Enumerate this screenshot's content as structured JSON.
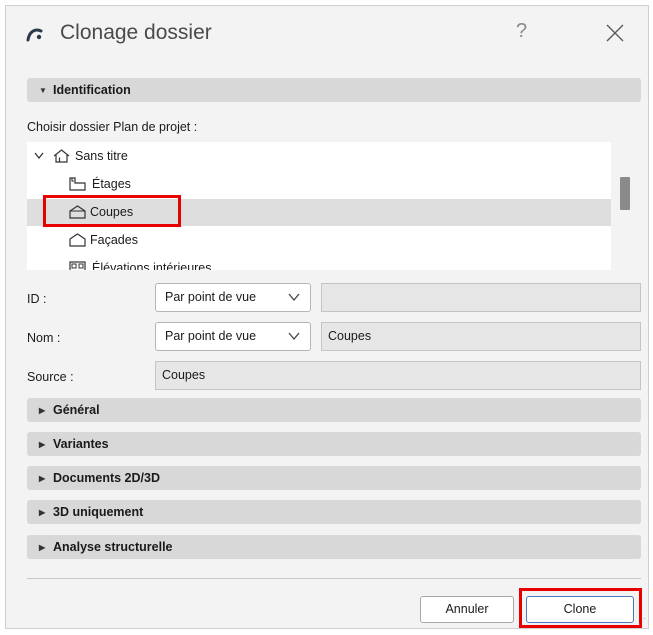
{
  "dialog": {
    "title": "Clonage dossier",
    "help_label": "?",
    "app_icon": "archicad-logo-icon",
    "close_icon": "close-icon"
  },
  "identification": {
    "header": "Identification",
    "choose_label": "Choisir dossier Plan de projet :",
    "tree": [
      {
        "label": "Sans titre",
        "icon": "project-house-icon",
        "expanded": true
      },
      {
        "label": "Étages",
        "icon": "stories-icon"
      },
      {
        "label": "Coupes",
        "icon": "sections-icon",
        "selected": true
      },
      {
        "label": "Façades",
        "icon": "elevations-icon"
      },
      {
        "label": "Élévations intérieures",
        "icon": "interior-elevations-icon"
      }
    ],
    "id_label": "ID :",
    "id_mode": "Par point de vue",
    "id_value": "",
    "name_label": "Nom :",
    "name_mode": "Par point de vue",
    "name_value": "Coupes",
    "source_label": "Source :",
    "source_value": "Coupes"
  },
  "sections": [
    {
      "label": "Général"
    },
    {
      "label": "Variantes"
    },
    {
      "label": "Documents 2D/3D"
    },
    {
      "label": "3D uniquement"
    },
    {
      "label": "Analyse structurelle"
    }
  ],
  "footer": {
    "cancel_label": "Annuler",
    "clone_label": "Clone"
  },
  "colors": {
    "highlight": "#e60000",
    "header_bg": "#d8d8d8",
    "selected_row": "#dedede"
  }
}
